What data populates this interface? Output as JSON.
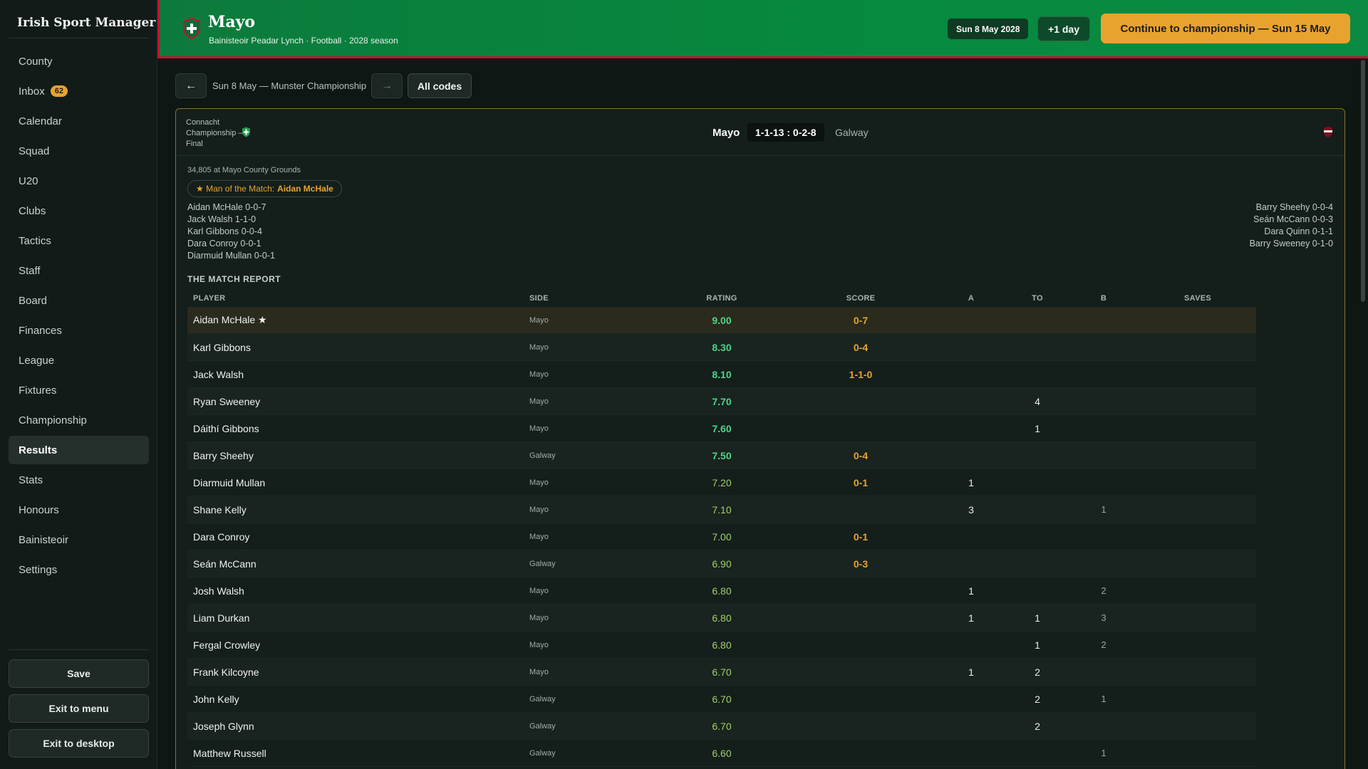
{
  "app": {
    "title": "Irish Sport Manager"
  },
  "sidebar": {
    "items": [
      {
        "label": "County",
        "name": "county"
      },
      {
        "label": "Inbox",
        "name": "inbox",
        "badge": "62"
      },
      {
        "label": "Calendar",
        "name": "calendar"
      },
      {
        "label": "Squad",
        "name": "squad"
      },
      {
        "label": "U20",
        "name": "u20"
      },
      {
        "label": "Clubs",
        "name": "clubs"
      },
      {
        "label": "Tactics",
        "name": "tactics"
      },
      {
        "label": "Staff",
        "name": "staff"
      },
      {
        "label": "Board",
        "name": "board"
      },
      {
        "label": "Finances",
        "name": "finances"
      },
      {
        "label": "League",
        "name": "league"
      },
      {
        "label": "Fixtures",
        "name": "fixtures"
      },
      {
        "label": "Championship",
        "name": "championship"
      },
      {
        "label": "Results",
        "name": "results",
        "active": true
      },
      {
        "label": "Stats",
        "name": "stats"
      },
      {
        "label": "Honours",
        "name": "honours"
      },
      {
        "label": "Bainisteoir",
        "name": "bainisteoir"
      },
      {
        "label": "Settings",
        "name": "settings"
      }
    ],
    "save_label": "Save",
    "exit_menu_label": "Exit to menu",
    "exit_desktop_label": "Exit to desktop"
  },
  "header": {
    "county": "Mayo",
    "subtitle": "Bainisteoir Peadar Lynch · Football · 2028 season",
    "date": "Sun 8 May 2028",
    "advance_label": "+1 day",
    "continue_label": "Continue to championship — Sun 15 May",
    "colors": {
      "primary": "#0a8a43",
      "secondary": "#c8102e",
      "accent": "#e8a32f"
    }
  },
  "toolbar": {
    "back_icon": "arrow-left-icon",
    "back_glyph": "←",
    "date_label": "Sun 8 May — Munster Championship",
    "forward_glyph": "→",
    "filter_label": "All codes"
  },
  "match": {
    "competition": "Connacht Championship — Final",
    "home": "Mayo",
    "score": "1-1-13 : 0-2-8",
    "away": "Galway",
    "attendance": "34,805 at Mayo County Grounds",
    "motm_prefix": "★ Man of the Match:",
    "motm_player": "Aidan McHale",
    "home_scorers": [
      "Aidan McHale 0-0-7",
      "Jack Walsh 1-1-0",
      "Karl Gibbons 0-0-4",
      "Dara Conroy 0-0-1",
      "Diarmuid Mullan 0-0-1"
    ],
    "away_scorers": [
      "Barry Sheehy 0-0-4",
      "Seán McCann 0-0-3",
      "Dara Quinn 0-1-1",
      "Barry Sweeney 0-1-0"
    ]
  },
  "report": {
    "title": "THE MATCH REPORT",
    "columns": [
      "PLAYER",
      "SIDE",
      "RATING",
      "SCORE",
      "A",
      "TO",
      "B",
      "SAVES"
    ],
    "rows": [
      {
        "player": "Aidan McHale ★",
        "side": "Mayo",
        "rating": "9.00",
        "score": "0-7",
        "a": "",
        "to": "",
        "b": "",
        "saves": "",
        "motm": true
      },
      {
        "player": "Karl Gibbons",
        "side": "Mayo",
        "rating": "8.30",
        "score": "0-4",
        "a": "",
        "to": "",
        "b": "",
        "saves": ""
      },
      {
        "player": "Jack Walsh",
        "side": "Mayo",
        "rating": "8.10",
        "score": "1-1-0",
        "a": "",
        "to": "",
        "b": "",
        "saves": ""
      },
      {
        "player": "Ryan Sweeney",
        "side": "Mayo",
        "rating": "7.70",
        "score": "",
        "a": "",
        "to": "4",
        "b": "",
        "saves": ""
      },
      {
        "player": "Dáithí Gibbons",
        "side": "Mayo",
        "rating": "7.60",
        "score": "",
        "a": "",
        "to": "1",
        "b": "",
        "saves": ""
      },
      {
        "player": "Barry Sheehy",
        "side": "Galway",
        "rating": "7.50",
        "score": "0-4",
        "a": "",
        "to": "",
        "b": "",
        "saves": ""
      },
      {
        "player": "Diarmuid Mullan",
        "side": "Mayo",
        "rating": "7.20",
        "score": "0-1",
        "a": "1",
        "to": "",
        "b": "",
        "saves": ""
      },
      {
        "player": "Shane Kelly",
        "side": "Mayo",
        "rating": "7.10",
        "score": "",
        "a": "3",
        "to": "",
        "b": "1",
        "saves": ""
      },
      {
        "player": "Dara Conroy",
        "side": "Mayo",
        "rating": "7.00",
        "score": "0-1",
        "a": "",
        "to": "",
        "b": "",
        "saves": ""
      },
      {
        "player": "Seán McCann",
        "side": "Galway",
        "rating": "6.90",
        "score": "0-3",
        "a": "",
        "to": "",
        "b": "",
        "saves": ""
      },
      {
        "player": "Josh Walsh",
        "side": "Mayo",
        "rating": "6.80",
        "score": "",
        "a": "1",
        "to": "",
        "b": "2",
        "saves": ""
      },
      {
        "player": "Liam Durkan",
        "side": "Mayo",
        "rating": "6.80",
        "score": "",
        "a": "1",
        "to": "1",
        "b": "3",
        "saves": ""
      },
      {
        "player": "Fergal Crowley",
        "side": "Mayo",
        "rating": "6.80",
        "score": "",
        "a": "",
        "to": "1",
        "b": "2",
        "saves": ""
      },
      {
        "player": "Frank Kilcoyne",
        "side": "Mayo",
        "rating": "6.70",
        "score": "",
        "a": "1",
        "to": "2",
        "b": "",
        "saves": ""
      },
      {
        "player": "John Kelly",
        "side": "Galway",
        "rating": "6.70",
        "score": "",
        "a": "",
        "to": "2",
        "b": "1",
        "saves": ""
      },
      {
        "player": "Joseph Glynn",
        "side": "Galway",
        "rating": "6.70",
        "score": "",
        "a": "",
        "to": "2",
        "b": "",
        "saves": ""
      },
      {
        "player": "Matthew Russell",
        "side": "Galway",
        "rating": "6.60",
        "score": "",
        "a": "",
        "to": "",
        "b": "1",
        "saves": ""
      }
    ]
  }
}
